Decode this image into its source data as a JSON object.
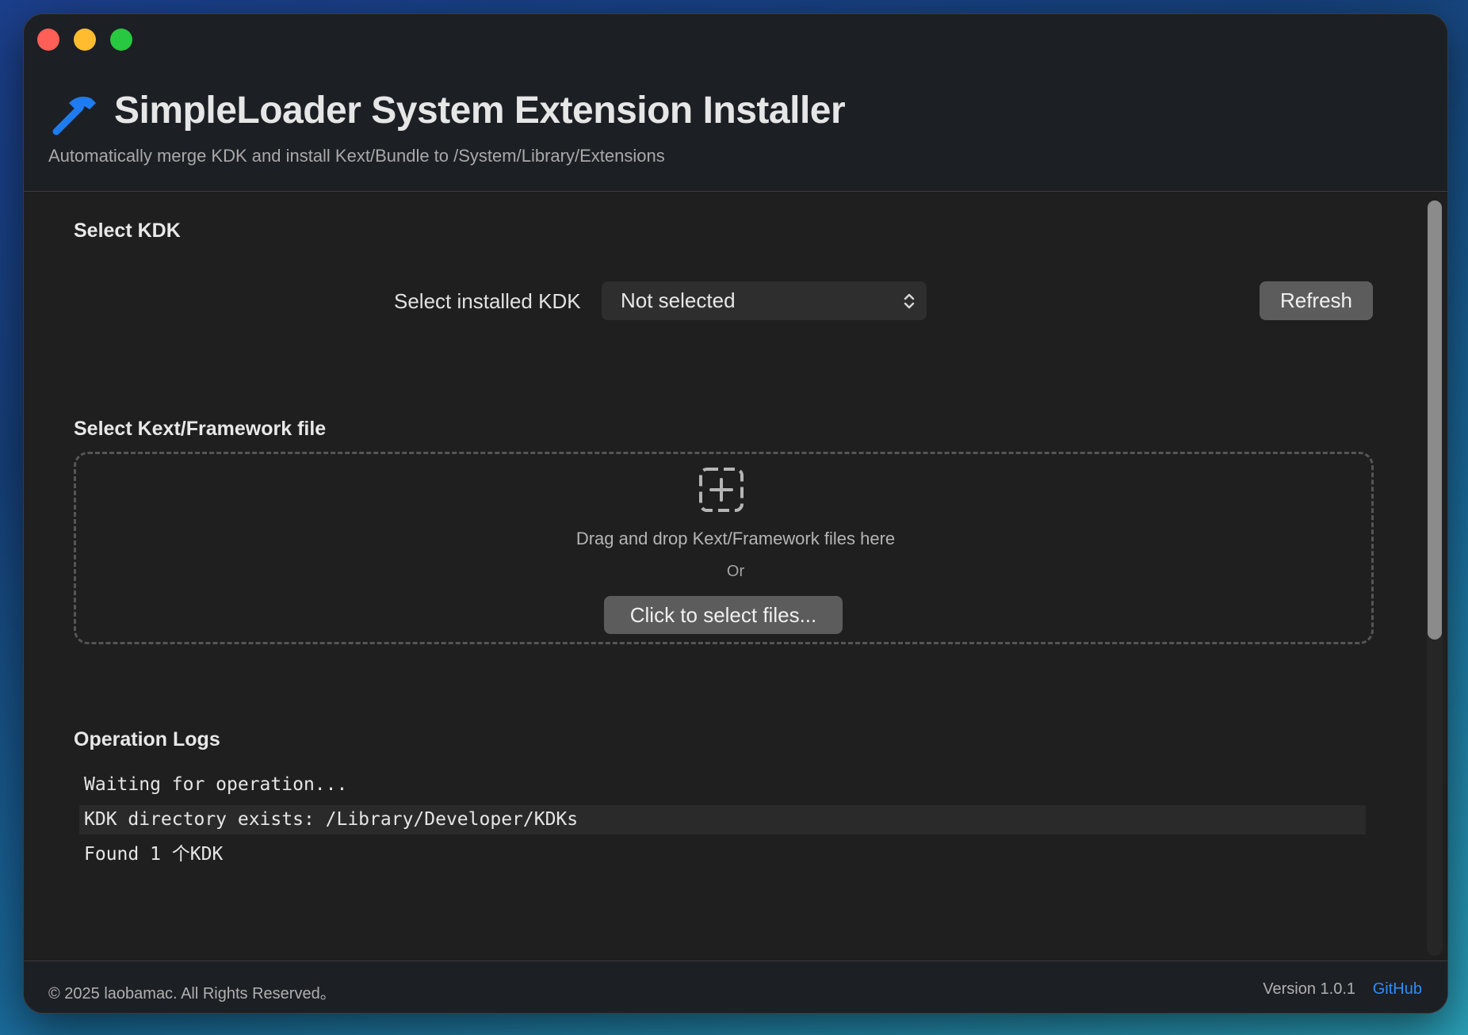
{
  "window": {
    "title": "SimpleLoader System Extension Installer",
    "subtitle": "Automatically merge KDK and install Kext/Bundle to /System/Library/Extensions",
    "app_icon": "hammer-icon",
    "traffic_lights": [
      "close",
      "minimize",
      "zoom"
    ]
  },
  "kdk_section": {
    "title": "Select KDK",
    "select_label": "Select installed KDK",
    "selected_value": "Not selected",
    "refresh_label": "Refresh"
  },
  "file_section": {
    "title": "Select Kext/Framework file",
    "drop_icon": "add-square-dashed-icon",
    "drop_text": "Drag and drop Kext/Framework files here",
    "or_text": "Or",
    "select_button_label": "Click to select files..."
  },
  "logs_section": {
    "title": "Operation Logs",
    "lines": [
      "Waiting for operation...",
      "KDK directory exists: /Library/Developer/KDKs",
      "Found 1 个KDK"
    ]
  },
  "footer": {
    "copyright": "© 2025 laobamac. All Rights Reserved。",
    "version": "Version 1.0.1",
    "github_label": "GitHub"
  },
  "colors": {
    "accent": "#2f8cf5",
    "window_bg": "#1e1e1e",
    "header_bg": "#1c1f24",
    "button_bg": "#5c5c5c",
    "close": "#fe5f57",
    "minimize": "#febc2e",
    "zoom": "#28c840"
  }
}
